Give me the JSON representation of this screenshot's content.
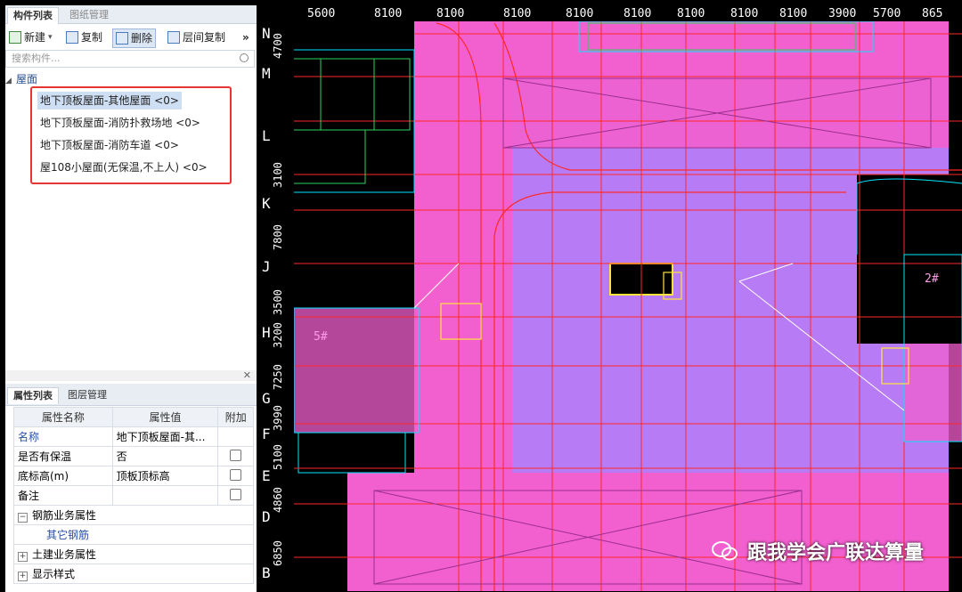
{
  "panel": {
    "tab1": "构件列表",
    "tab2": "图纸管理",
    "toolbar": {
      "new": "新建",
      "new_arrow": "▾",
      "copy": "复制",
      "delete": "删除",
      "floor_copy": "层间复制",
      "more": "»"
    },
    "search_placeholder": "搜索构件...",
    "tree_root": "屋面",
    "items": [
      "地下顶板屋面-其他屋面 <0>",
      "地下顶板屋面-消防扑救场地 <0>",
      "地下顶板屋面-消防车道 <0>",
      "屋108小屋面(无保温,不上人) <0>"
    ],
    "close": "✕"
  },
  "props": {
    "tab1": "属性列表",
    "tab2": "图层管理",
    "headers": [
      "属性名称",
      "属性值",
      "附加"
    ],
    "rows": [
      {
        "name": "名称",
        "value": "地下顶板屋面-其..."
      },
      {
        "name": "是否有保温",
        "value": "否"
      },
      {
        "name": "底标高(m)",
        "value": "顶板顶标高"
      },
      {
        "name": "备注",
        "value": ""
      }
    ],
    "groups": [
      {
        "sign": "−",
        "label": "钢筋业务属性"
      },
      {
        "child": "其它钢筋"
      },
      {
        "sign": "+",
        "label": "土建业务属性"
      },
      {
        "sign": "+",
        "label": "显示样式"
      }
    ]
  },
  "canvas": {
    "axis_rows": [
      "N",
      "M",
      "L",
      "K",
      "J",
      "H",
      "G",
      "F",
      "E",
      "D",
      "B"
    ],
    "dims_left": [
      "4700",
      "3100",
      "7800",
      "3500",
      "3200",
      "7250",
      "3990",
      "5100",
      "4860",
      "6850"
    ],
    "dims_top": [
      "5600",
      "8100",
      "8100",
      "8100",
      "8100",
      "8100",
      "8100",
      "8100",
      "8100",
      "3900",
      "5700",
      "865"
    ],
    "blocks": [
      "5#",
      "2#"
    ],
    "colors": {
      "pink": "#f25fcf",
      "violet": "#b77cf5",
      "red": "#ff2828",
      "cyan": "#00e5ff",
      "green": "#27d65a",
      "yellow": "#ffe53b"
    }
  },
  "watermark": "跟我学会广联达算量"
}
